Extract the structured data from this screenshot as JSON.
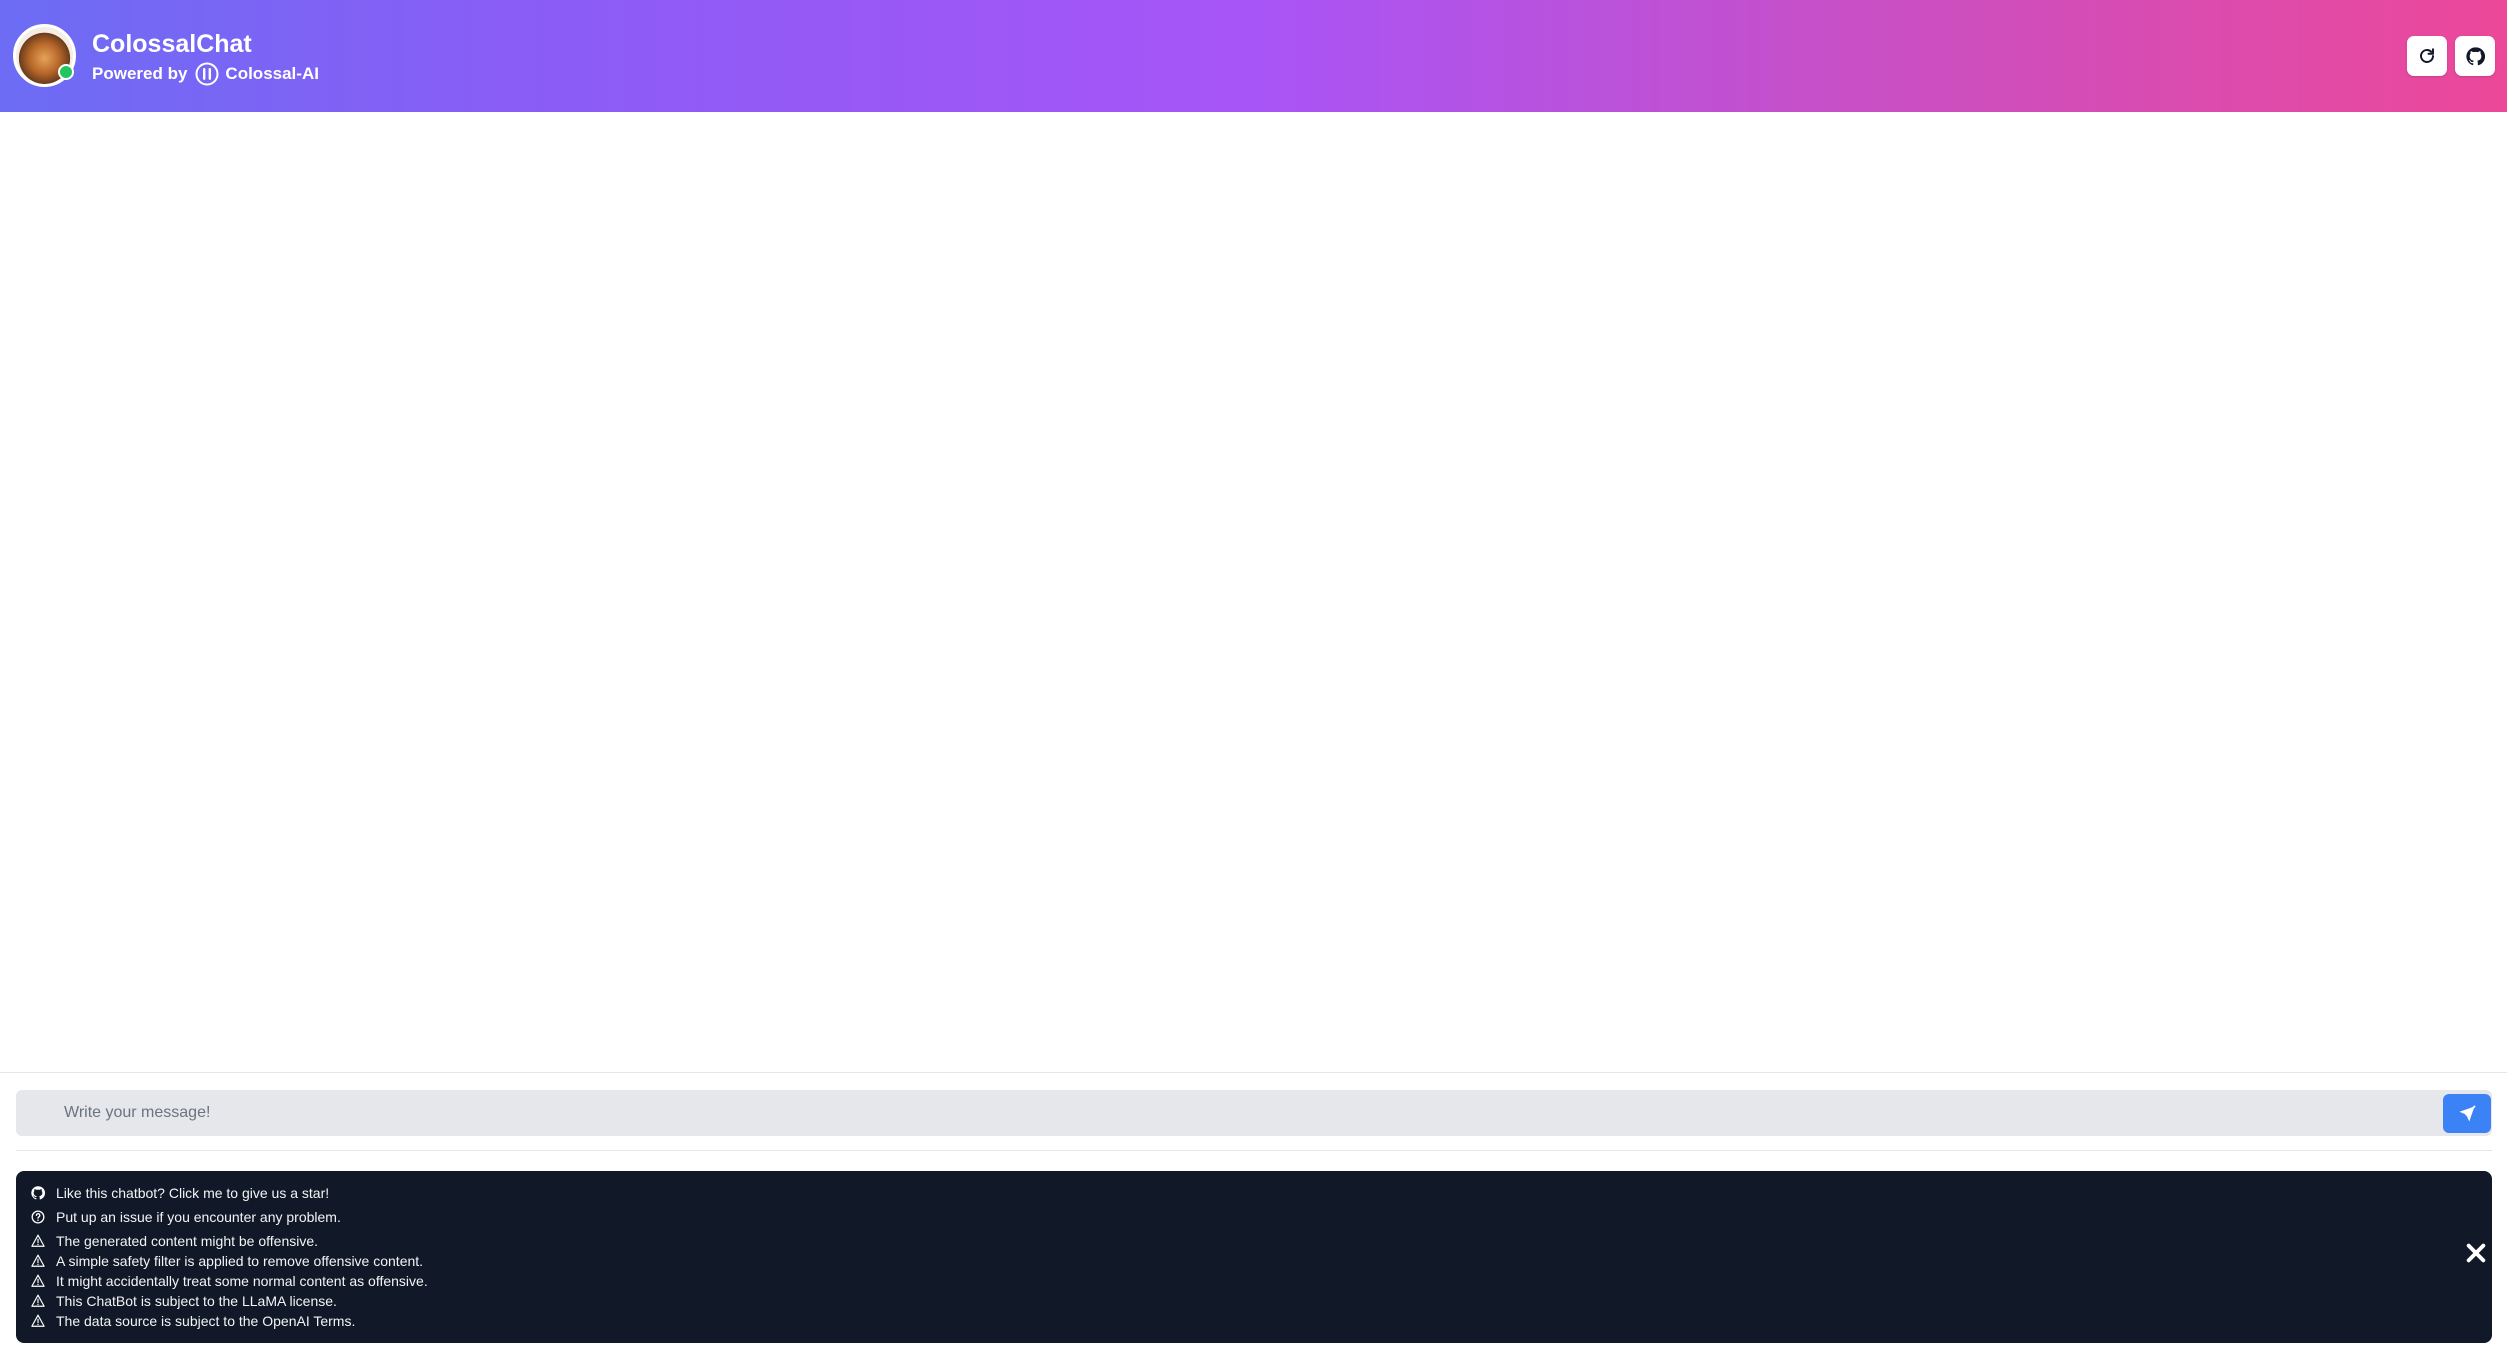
{
  "header": {
    "title": "ColossalChat",
    "powered_by": "Powered by",
    "brand": "Colossal-AI",
    "avatar_status": "online"
  },
  "chat": {
    "input_placeholder": "Write your message!",
    "input_value": ""
  },
  "notices": [
    {
      "icon": "github-icon",
      "text": "Like this chatbot? Click me to give us a star!"
    },
    {
      "icon": "question-circle-icon",
      "text": "Put up an issue if you encounter any problem."
    },
    {
      "icon": "warning-icon",
      "text": "The generated content might be offensive."
    },
    {
      "icon": "warning-icon",
      "text": "A simple safety filter is applied to remove offensive content."
    },
    {
      "icon": "warning-icon",
      "text": "It might accidentally treat some normal content as offensive."
    },
    {
      "icon": "warning-icon",
      "text": "This ChatBot is subject to the LLaMA license."
    },
    {
      "icon": "warning-icon",
      "text": "The data source is subject to the OpenAI Terms."
    }
  ],
  "colors": {
    "header_gradient_start": "#6c6cf4",
    "header_gradient_end": "#ec4899",
    "send_button": "#3b82f6",
    "notice_background": "#111827",
    "online_indicator": "#22c55e"
  }
}
